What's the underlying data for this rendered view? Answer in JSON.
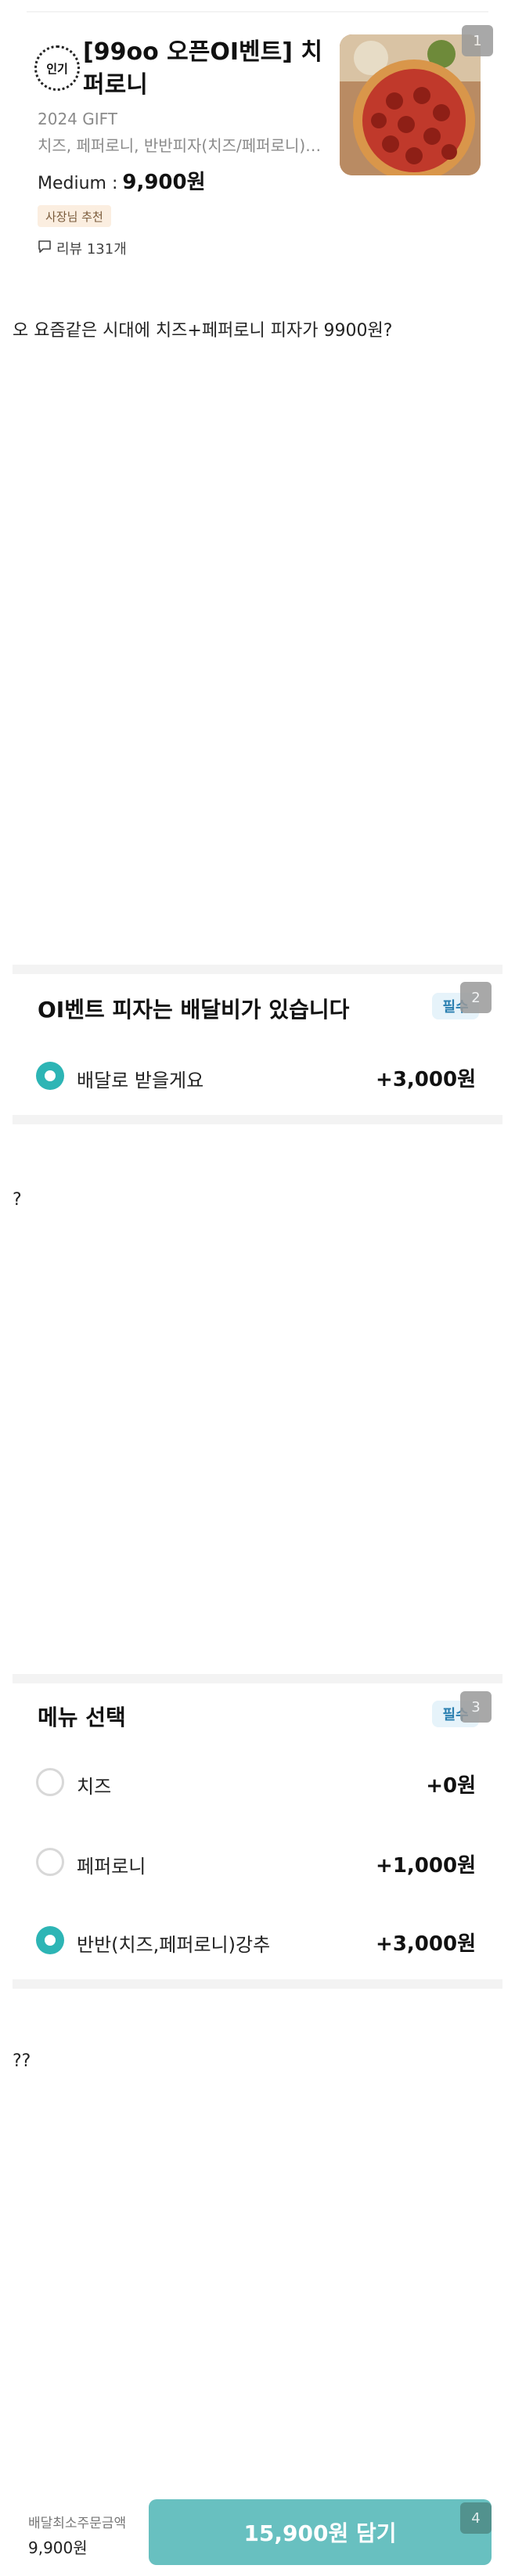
{
  "product": {
    "badge": "인기",
    "title": "[99oo 오픈OI벤트] 치퍼로니",
    "subtitle": "2024 GIFT",
    "description": "치즈, 페퍼로니, 반반피자(치즈/페퍼로니)…",
    "size_label": "Medium :",
    "price": "9,900원",
    "owner_badge": "사장님 추천",
    "review_label": "리뷰 131개"
  },
  "review_text_1": "오 요즘같은 시대에 치즈+페퍼로니 피자가 9900원?",
  "section_delivery": {
    "title": "OI벤트 피자는 배달비가 있습니다",
    "required": "필수",
    "options": [
      {
        "label": "배달로 받을게요",
        "price": "+3,000원",
        "selected": true
      }
    ]
  },
  "review_text_2": "?",
  "section_menu": {
    "title": "메뉴 선택",
    "required": "필수",
    "options": [
      {
        "label": "치즈",
        "price": "+0원",
        "selected": false
      },
      {
        "label": "페퍼로니",
        "price": "+1,000원",
        "selected": false
      },
      {
        "label": "반반(치즈,페퍼로니)강추",
        "price": "+3,000원",
        "selected": true
      }
    ]
  },
  "review_text_3": "??",
  "footer": {
    "min_order_label": "배달최소주문금액",
    "min_order_value": "9,900원",
    "add_button_label": "15,900원 담기"
  },
  "overlay_numbers": [
    "1",
    "2",
    "3",
    "4"
  ],
  "colors": {
    "accent": "#2db5b5",
    "button": "#68c0c0",
    "required_bg": "#e6f3fa"
  },
  "icons": [
    "popular-badge-icon",
    "comment-icon",
    "radio-selected-icon",
    "radio-empty-icon"
  ]
}
